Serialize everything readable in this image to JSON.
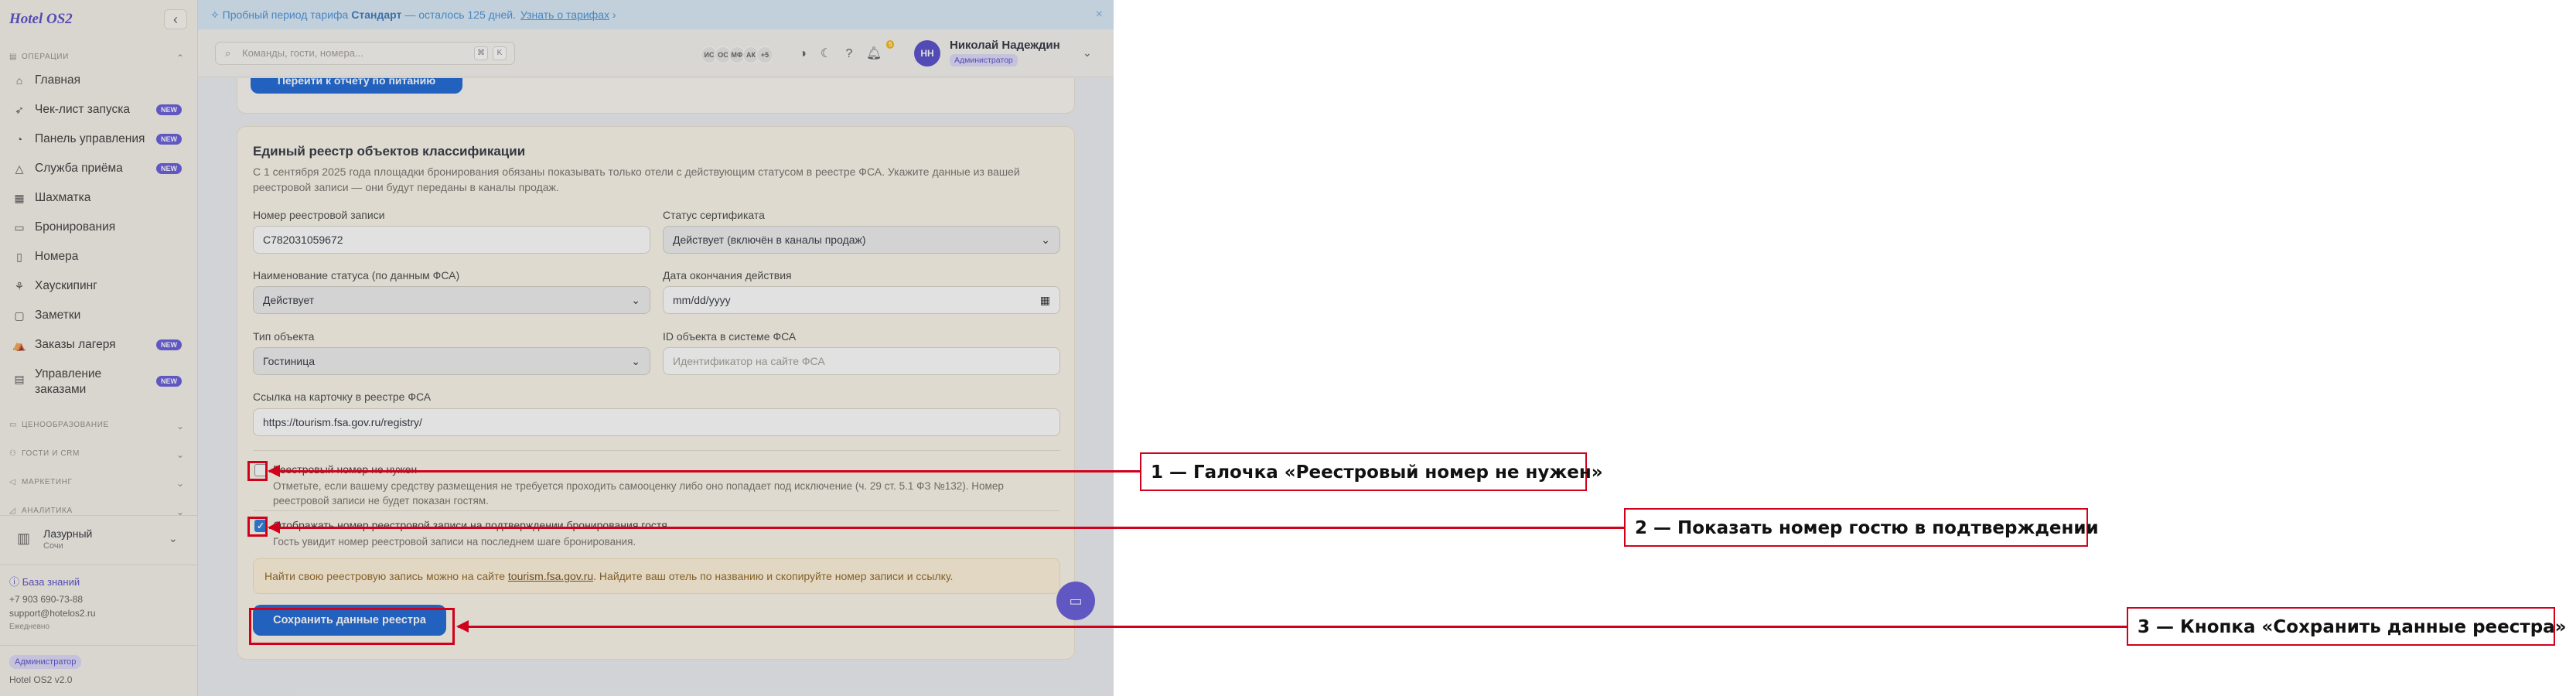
{
  "sidebar": {
    "brand": "Hotel OS2",
    "sections": {
      "operations": "Операции",
      "pricing": "Ценообразование",
      "guests": "Гости и CRM",
      "marketing": "Маркетинг",
      "analytics": "Аналитика"
    },
    "items": [
      {
        "label": "Главная",
        "icon": "home-icon"
      },
      {
        "label": "Чек-лист запуска",
        "icon": "rocket-icon",
        "badge": "NEW"
      },
      {
        "label": "Панель управления",
        "icon": "gauge-icon",
        "badge": "NEW"
      },
      {
        "label": "Служба приёма",
        "icon": "bell-icon",
        "badge": "NEW"
      },
      {
        "label": "Шахматка",
        "icon": "grid-icon"
      },
      {
        "label": "Бронирования",
        "icon": "calendar-icon"
      },
      {
        "label": "Номера",
        "icon": "door-icon"
      },
      {
        "label": "Хаускипинг",
        "icon": "broom-icon"
      },
      {
        "label": "Заметки",
        "icon": "note-icon"
      },
      {
        "label": "Заказы лагеря",
        "icon": "tent-icon",
        "badge": "NEW"
      },
      {
        "label": "Управление заказами",
        "icon": "clipboard-icon",
        "badge": "NEW"
      }
    ],
    "hotel": {
      "name": "Лазурный",
      "city": "Сочи"
    },
    "knowledge_base": "База знаний",
    "phone": "+7 903 690-73-88",
    "email": "support@hotelos2.ru",
    "schedule": "Ежедневно",
    "role": "Администратор",
    "version": "Hotel OS2 v2.0"
  },
  "trial": {
    "prefix": "Пробный период тарифа",
    "plan": "Стандарт",
    "remaining": "— осталось 125 дней.",
    "link": "Узнать о тарифах"
  },
  "topbar": {
    "search_placeholder": "Команды, гости, номера...",
    "kbd": [
      "⌘",
      "K"
    ],
    "avatars": [
      "ИС",
      "ОС",
      "МФ",
      "АК",
      "+5"
    ],
    "bell_count": "5",
    "user_initials": "НН",
    "user_name": "Николай Надеждин",
    "user_role": "Администратор"
  },
  "prev_card": {
    "button": "Перейти к отчету по питанию"
  },
  "registry": {
    "title": "Единый реестр объектов классификации",
    "description": "С 1 сентября 2025 года площадки бронирования обязаны показывать только отели с действующим статусом в реестре ФСА. Укажите данные из вашей реестровой записи — они будут переданы в каналы продаж.",
    "record_number_label": "Номер реестровой записи",
    "record_number_value": "С782031059672",
    "cert_status_label": "Статус сертификата",
    "cert_status_value": "Действует (включён в каналы продаж)",
    "status_name_label": "Наименование статуса (по данным ФСА)",
    "status_name_value": "Действует",
    "expiry_label": "Дата окончания действия",
    "expiry_value": "mm/dd/yyyy",
    "object_type_label": "Тип объекта",
    "object_type_value": "Гостиница",
    "fsa_id_label": "ID объекта в системе ФСА",
    "fsa_id_placeholder": "Идентификатор на сайте ФСА",
    "card_link_label": "Ссылка на карточку в реестре ФСА",
    "card_link_value": "https://tourism.fsa.gov.ru/registry/",
    "no_number_label": "Реестровый номер не нужен",
    "no_number_desc": "Отметьте, если вашему средству размещения не требуется проходить самооценку либо оно попадает под исключение (ч. 29 ст. 5.1 ФЗ №132). Номер реестровой записи не будет показан гостям.",
    "no_number_checked": false,
    "show_number_label": "Отображать номер реестровой записи на подтверждении бронирования гостя",
    "show_number_desc": "Гость увидит номер реестровой записи на последнем шаге бронирования.",
    "show_number_checked": true,
    "note_prefix": "Найти свою реестровую запись можно на сайте",
    "note_link": "tourism.fsa.gov.ru",
    "note_suffix": ". Найдите ваш отель по названию и скопируйте номер записи и ссылку.",
    "save_button": "Сохранить данные реестра"
  },
  "annotations": [
    {
      "label": "1 — Галочка «Реестровый номер не нужен»"
    },
    {
      "label": "2 — Показать номер гостю в подтверждении"
    },
    {
      "label": "3 — Кнопка «Сохранить данные реестра»"
    }
  ],
  "colors": {
    "accent": "#4a3fc7",
    "primary_button": "#0b5bd3",
    "annotation": "#d0021b",
    "trial_bg": "#d7e9f8"
  }
}
